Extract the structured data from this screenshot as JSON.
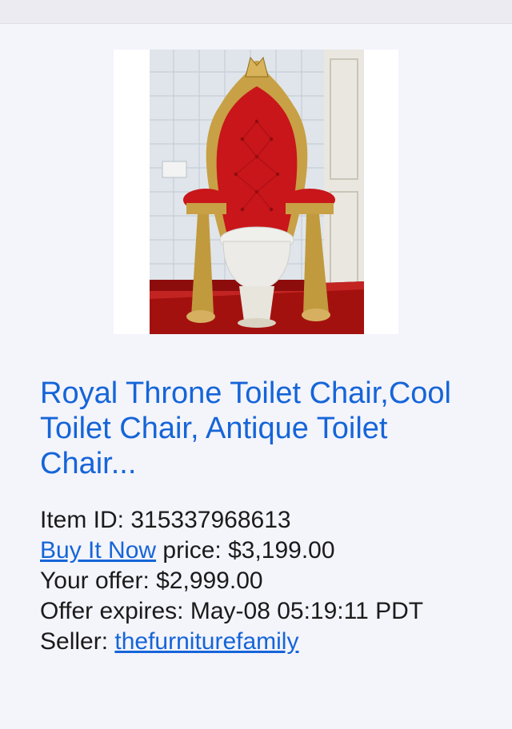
{
  "listing": {
    "title": "Royal Throne Toilet Chair,Cool Toilet Chair, Antique Toilet Chair...",
    "item_id_label": "Item ID: ",
    "item_id": "315337968613",
    "buy_it_now_label": "Buy It Now",
    "price_label": " price: ",
    "price": "$3,199.00",
    "offer_label": "Your offer: ",
    "offer": "$2,999.00",
    "expires_label": "Offer expires: ",
    "expires": "May-08 05:19:11 PDT",
    "seller_label": "Seller: ",
    "seller": "thefurniturefamily"
  },
  "colors": {
    "link": "#1565d8",
    "text": "#1b1b1b",
    "background": "#f4f4fb"
  }
}
